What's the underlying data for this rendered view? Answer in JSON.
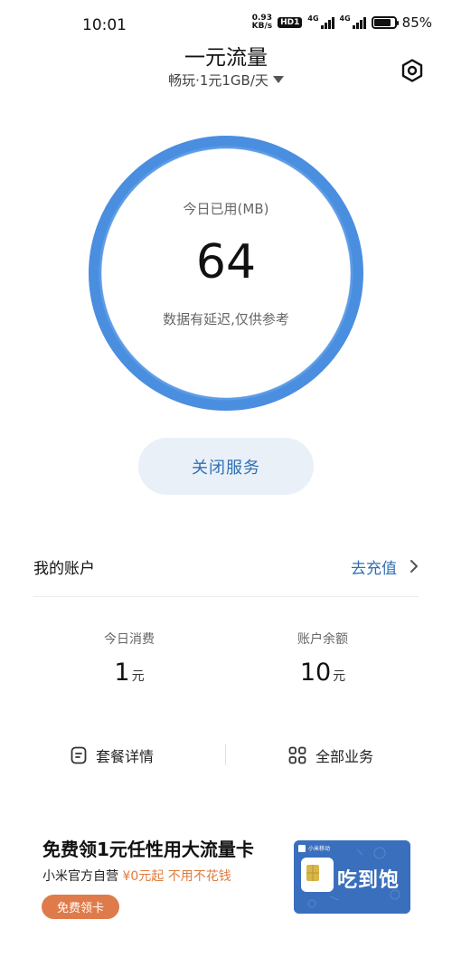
{
  "status_bar": {
    "time": "10:01",
    "net_speed_value": "0.93",
    "net_speed_unit": "KB/s",
    "hd_badge": "HD1",
    "net_type_1": "4G",
    "net_type_2": "4G",
    "battery": "85%"
  },
  "header": {
    "title": "一元流量",
    "plan_selector": "畅玩·1元1GB/天",
    "settings_icon": "gear-hexagon-icon"
  },
  "usage": {
    "label": "今日已用(MB)",
    "value": "64",
    "note": "数据有延迟,仅供参考",
    "ring_color": "#4a8ee0"
  },
  "actions": {
    "close_service": "关闭服务"
  },
  "account": {
    "title": "我的账户",
    "recharge": "去充值",
    "today_cost_label": "今日消费",
    "today_cost_value": "1",
    "today_cost_unit": "元",
    "balance_label": "账户余额",
    "balance_value": "10",
    "balance_unit": "元"
  },
  "quick_links": {
    "plan_details": "套餐详情",
    "all_services": "全部业务"
  },
  "promo": {
    "title": "免费领1元任性用大流量卡",
    "sub_prefix": "小米官方自营",
    "sub_highlight": "¥0元起 不用不花钱",
    "button": "免费领卡",
    "card_brand": "小米移动",
    "card_slogan": "吃到饱"
  },
  "colors": {
    "accent_blue": "#2f6fb3",
    "promo_orange": "#df7b4a",
    "card_blue": "#3a6fbd"
  }
}
